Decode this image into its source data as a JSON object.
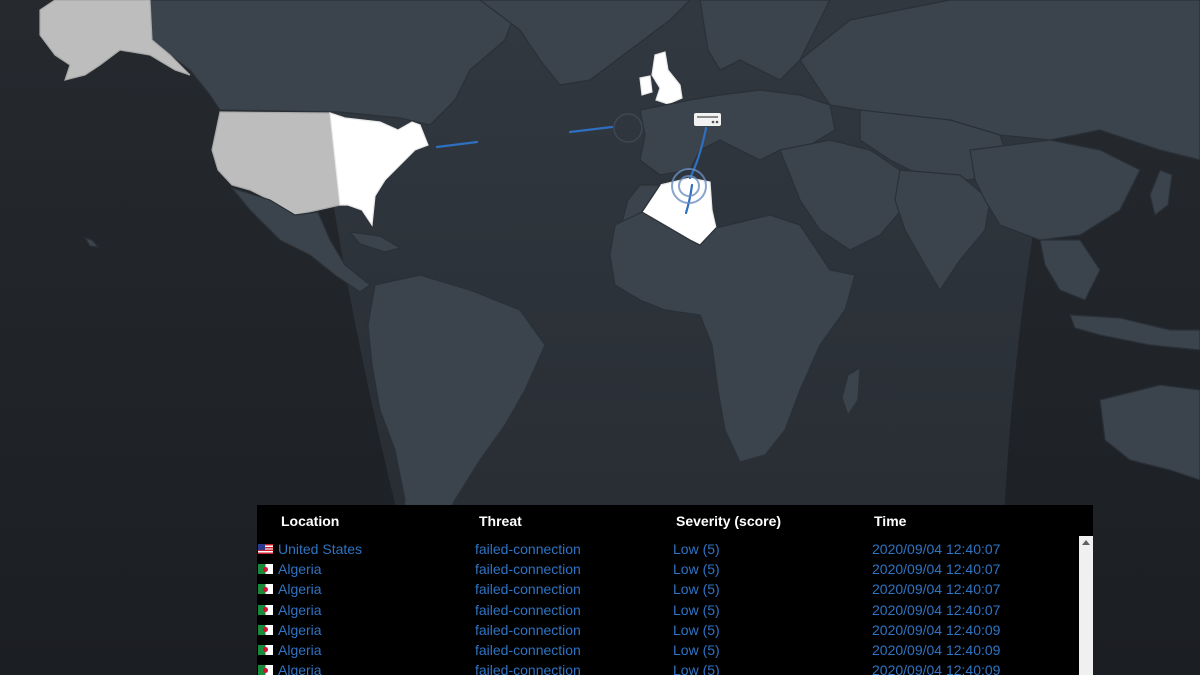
{
  "table": {
    "columns": [
      "Location",
      "Threat",
      "Severity (score)",
      "Time"
    ],
    "rows": [
      {
        "flag": "us-flag-icon",
        "location": "United States",
        "threat": "failed-connection",
        "severity": "Low (5)",
        "time": "2020/09/04 12:40:07"
      },
      {
        "flag": "algeria-flag-icon",
        "location": "Algeria",
        "threat": "failed-connection",
        "severity": "Low (5)",
        "time": "2020/09/04 12:40:07"
      },
      {
        "flag": "algeria-flag-icon",
        "location": "Algeria",
        "threat": "failed-connection",
        "severity": "Low (5)",
        "time": "2020/09/04 12:40:07"
      },
      {
        "flag": "algeria-flag-icon",
        "location": "Algeria",
        "threat": "failed-connection",
        "severity": "Low (5)",
        "time": "2020/09/04 12:40:07"
      },
      {
        "flag": "algeria-flag-icon",
        "location": "Algeria",
        "threat": "failed-connection",
        "severity": "Low (5)",
        "time": "2020/09/04 12:40:09"
      },
      {
        "flag": "algeria-flag-icon",
        "location": "Algeria",
        "threat": "failed-connection",
        "severity": "Low (5)",
        "time": "2020/09/04 12:40:09"
      },
      {
        "flag": "algeria-flag-icon",
        "location": "Algeria",
        "threat": "failed-connection",
        "severity": "Low (5)",
        "time": "2020/09/04 12:40:09"
      }
    ]
  },
  "map": {
    "highlighted_countries": [
      "United States",
      "United Kingdom",
      "Algeria"
    ],
    "colors": {
      "background": "#23272c",
      "land": "#3b434c",
      "daylight_band": "#2f353c",
      "highlight": "#ffffff",
      "highlight_grey": "#bdbdbd",
      "attack_line": "#2f6fbf",
      "table_text": "#2e74c4"
    },
    "icons": [
      "server-device-icon",
      "target-ring-icon"
    ]
  }
}
